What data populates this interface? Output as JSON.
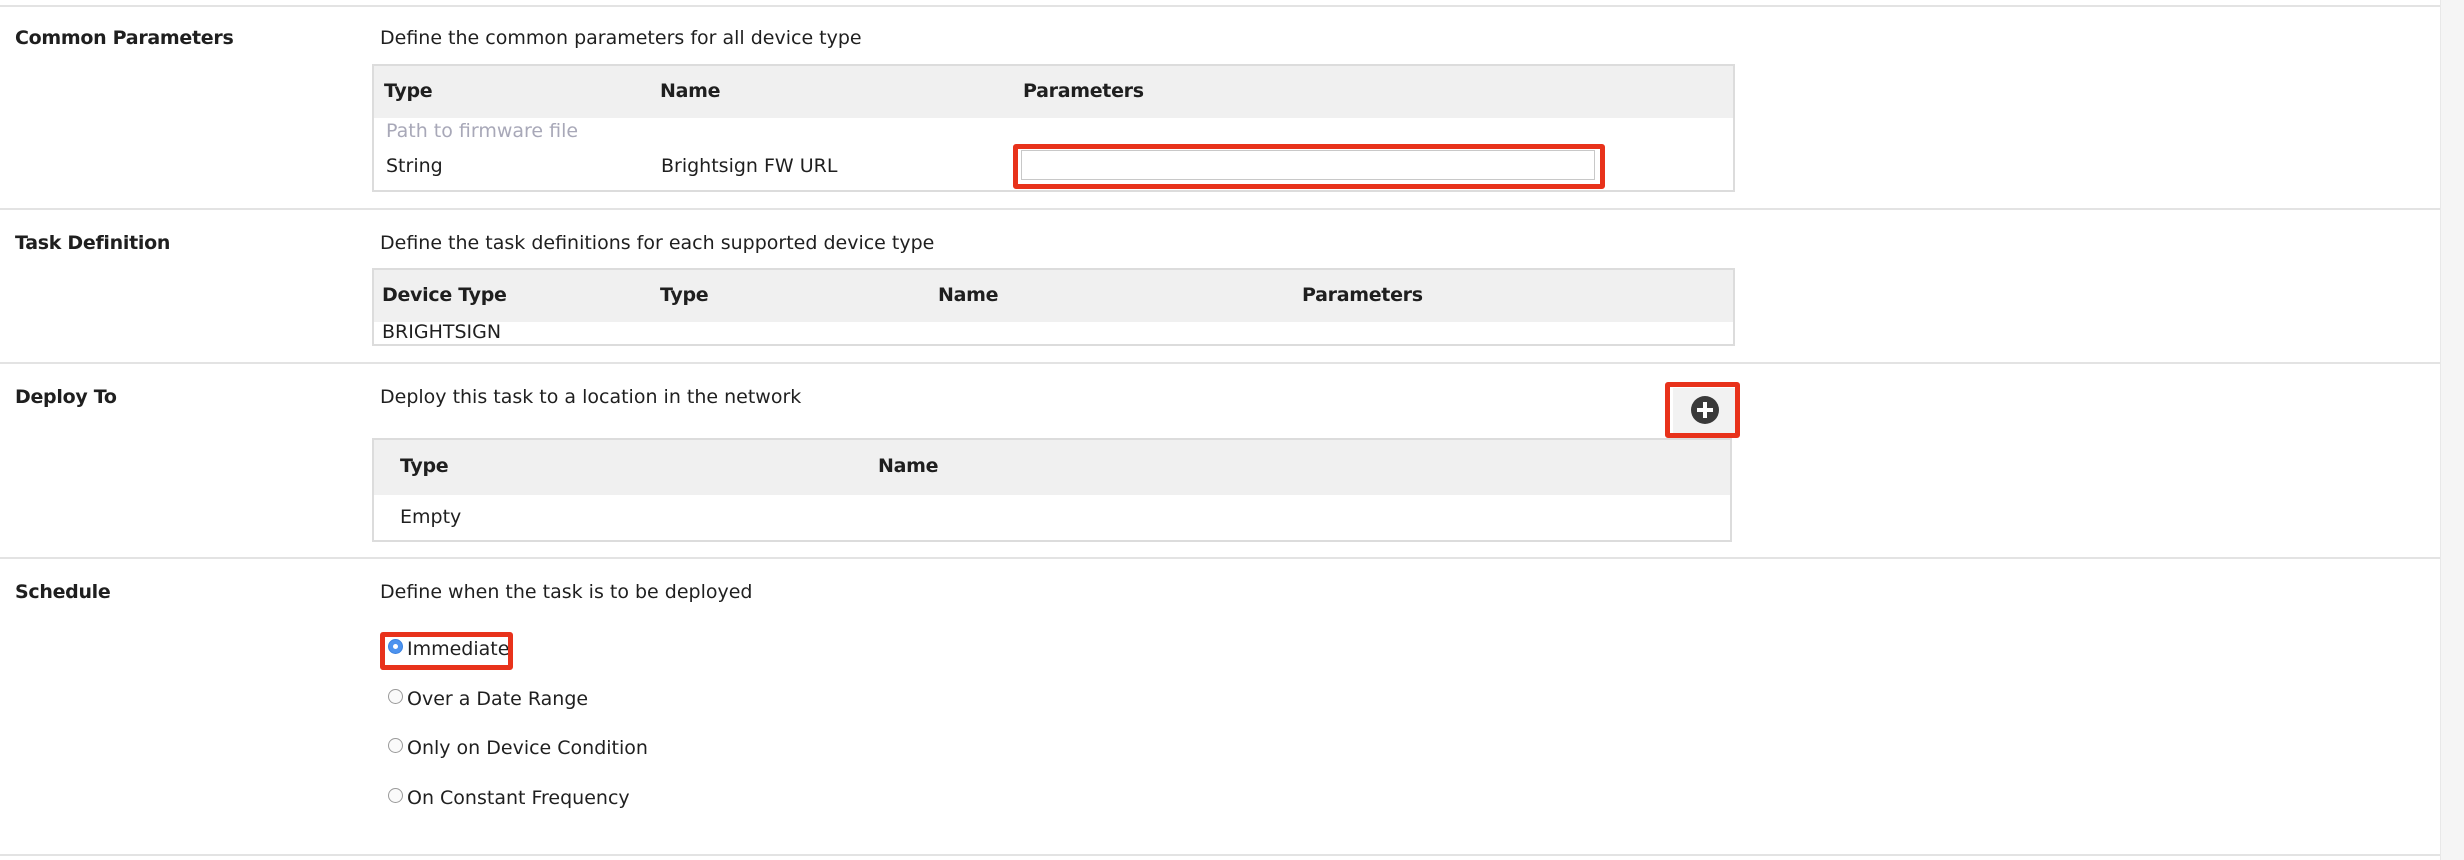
{
  "sections": {
    "common": {
      "label": "Common Parameters",
      "description": "Define the common parameters for all device type",
      "headers": [
        "Type",
        "Name",
        "Parameters"
      ],
      "row_hint": "Path to firmware file",
      "row": {
        "type": "String",
        "name": "Brightsign FW URL",
        "parameter_value": ""
      }
    },
    "task": {
      "label": "Task Definition",
      "description": "Define the task definitions for each supported device type",
      "headers": [
        "Device Type",
        "Type",
        "Name",
        "Parameters"
      ],
      "row": {
        "device_type": "BRIGHTSIGN"
      }
    },
    "deploy": {
      "label": "Deploy To",
      "description": "Deploy this task to a location in the network",
      "headers": [
        "Type",
        "Name"
      ],
      "row": {
        "type": "Empty"
      },
      "add_icon": "plus-circle-icon"
    },
    "schedule": {
      "label": "Schedule",
      "description": "Define when the task is to be deployed",
      "options": [
        {
          "label": "Immediate",
          "selected": true
        },
        {
          "label": "Over a Date Range",
          "selected": false
        },
        {
          "label": "Only on Device Condition",
          "selected": false
        },
        {
          "label": "On Constant Frequency",
          "selected": false
        }
      ]
    }
  },
  "colors": {
    "highlight": "#e8321b",
    "header_bg": "#f0f0f0",
    "radio_selected": "#4c93ef"
  }
}
